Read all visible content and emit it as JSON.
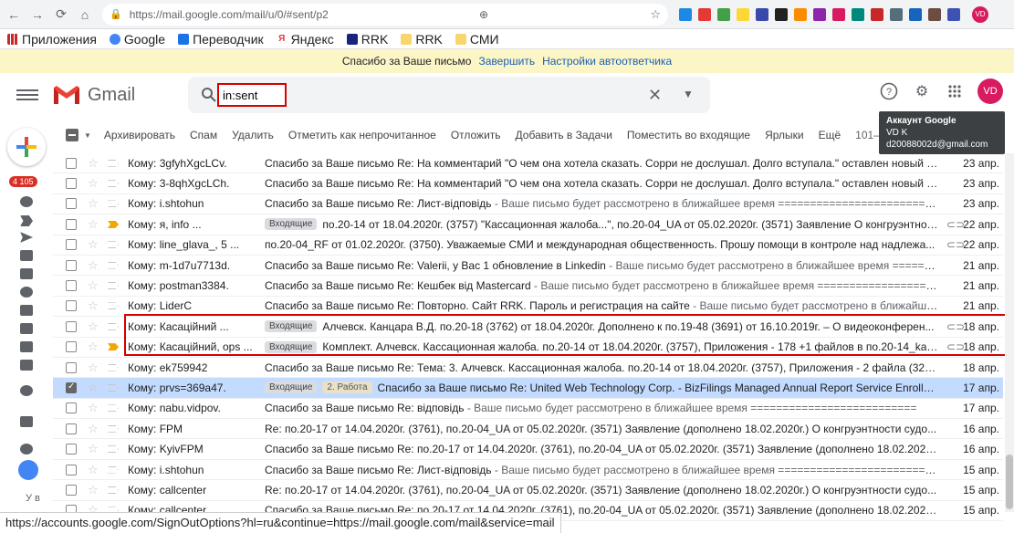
{
  "browser": {
    "url": "https://mail.google.com/mail/u/0/#sent/p2",
    "profile_initials": "VD"
  },
  "bookmarks": [
    {
      "label": "Приложения"
    },
    {
      "label": "Google"
    },
    {
      "label": "Переводчик"
    },
    {
      "label": "Яндекс"
    },
    {
      "label": "RRK"
    },
    {
      "label": "RRK"
    },
    {
      "label": "СМИ"
    }
  ],
  "vacation": {
    "text": "Спасибо за Ваше письмо",
    "end_link": "Завершить",
    "settings_link": "Настройки автоответчика"
  },
  "header": {
    "app_name": "Gmail",
    "search_value": "in:sent",
    "avatar_initials": "VD"
  },
  "tooltip": {
    "title": "Аккаунт Google",
    "name": "VD K",
    "email": "d20088002d@gmail.com"
  },
  "rail": {
    "unread_count": "4 105",
    "user_label": "У в"
  },
  "toolbar": {
    "archive": "Архивировать",
    "spam": "Спам",
    "delete": "Удалить",
    "mark_unread": "Отметить как непрочитанное",
    "snooze": "Отложить",
    "add_tasks": "Добавить в Задачи",
    "move_inbox": "Поместить во входящие",
    "labels": "Ярлыки",
    "more": "Ещё",
    "range": "101–"
  },
  "emails": [
    {
      "from": "Кому: 3gfyhXgcLCv.",
      "labels": [],
      "subject": "Спасибо за Ваше письмо Re: На комментарий \"О чем она хотела сказать. Сорри не дослушал. Долго вступала.\" оставлен новый от...",
      "snippet": "",
      "attach": false,
      "important": false,
      "selected": false,
      "date": "23 апр."
    },
    {
      "from": "Кому: 3-8qhXgcLCh.",
      "labels": [],
      "subject": "Спасибо за Ваше письмо Re: На комментарий \"О чем она хотела сказать. Сорри не дослушал. Долго вступала.\" оставлен новый от...",
      "snippet": "",
      "attach": false,
      "important": false,
      "selected": false,
      "date": "23 апр."
    },
    {
      "from": "Кому: i.shtohun",
      "labels": [],
      "subject": "Спасибо за Ваше письмо Re: Лист-відповідь",
      "snippet": " - Ваше письмо будет рассмотрено в ближайшее время ==========================",
      "attach": false,
      "important": false,
      "selected": false,
      "date": "23 апр."
    },
    {
      "from": "Кому: я, info ...",
      "labels": [
        "Входящие"
      ],
      "subject": "по.20-14 от 18.04.2020г. (3757) \"Кассационная жалоба...\", по.20-04_UA от 05.02.2020г. (3571) Заявление О конгруэнтност...",
      "snippet": "",
      "attach": true,
      "important": true,
      "selected": false,
      "date": "22 апр."
    },
    {
      "from": "Кому: line_glava_, 5 ...",
      "labels": [],
      "subject": "по.20-04_RF от 01.02.2020г. (3750). Уважаемые СМИ и международная общественность. Прошу помощи в контроле над надлежа...",
      "snippet": "",
      "attach": true,
      "important": false,
      "selected": false,
      "date": "22 апр."
    },
    {
      "from": "Кому: m-1d7u7713d.",
      "labels": [],
      "subject": "Спасибо за Ваше письмо Re: Valerii, у Вас 1 обновление в Linkedin",
      "snippet": " - Ваше письмо будет рассмотрено в ближайшее время ==========",
      "attach": false,
      "important": false,
      "selected": false,
      "date": "21 апр."
    },
    {
      "from": "Кому: postman3384.",
      "labels": [],
      "subject": "Спасибо за Ваше письмо Re: Кешбек від Mastercard",
      "snippet": " - Ваше письмо будет рассмотрено в ближайшее время =====================",
      "attach": false,
      "important": false,
      "selected": false,
      "date": "21 апр."
    },
    {
      "from": "Кому: LiderC",
      "labels": [],
      "subject": "Спасибо за Ваше письмо Re: Повторно. Сайт RRK. Пароль и регистрация на сайте",
      "snippet": " - Ваше письмо будет рассмотрено в ближайшее ...",
      "attach": false,
      "important": false,
      "selected": false,
      "date": "21 апр."
    },
    {
      "from": "Кому: Касаційний ...",
      "labels": [
        "Входящие"
      ],
      "subject": "Алчевск. Канцара В.Д. по.20-18 (3762) от 18.04.2020г. Дополнено к по.19-48 (3691) от 16.10.2019г. – О видеоконферен...",
      "snippet": "",
      "attach": true,
      "important": false,
      "selected": false,
      "date": "18 апр."
    },
    {
      "from": "Кому: Касаційний, ops ...",
      "labels": [
        "Входящие"
      ],
      "subject": "Комплект. Алчевск. Кассационная жалоба. по.20-14 от 18.04.2020г. (3757), Приложения - 178 +1 файлов в по.20-14_kas...",
      "snippet": "",
      "attach": true,
      "important": true,
      "selected": false,
      "date": "18 апр."
    },
    {
      "from": "Кому: ek759942",
      "labels": [],
      "subject": "Спасибо за Ваше письмо Re: Тема: 3. Алчевск. Кассационная жалоба. по.20-14 от 18.04.2020г. (3757), Приложения - 2 файла (324,...",
      "snippet": "",
      "attach": false,
      "important": false,
      "selected": false,
      "date": "18 апр."
    },
    {
      "from": "Кому: prvs=369a47.",
      "labels": [
        "Входящие",
        "2. Работа"
      ],
      "subject": "Спасибо за Ваше письмо Re: United Web Technology Corp. - BizFilings Managed Annual Report Service Enrollment ...",
      "snippet": "",
      "attach": false,
      "important": false,
      "selected": true,
      "date": "17 апр."
    },
    {
      "from": "Кому: nabu.vidpov.",
      "labels": [],
      "subject": "Спасибо за Ваше письмо Re: відповідь",
      "snippet": " - Ваше письмо будет рассмотрено в ближайшее время ==========================",
      "attach": false,
      "important": false,
      "selected": false,
      "date": "17 апр."
    },
    {
      "from": "Кому: FPM",
      "labels": [],
      "subject": "Re: по.20-17 от 14.04.2020г. (3761), по.20-04_UA от 05.02.2020г. (3571) Заявление (дополнено 18.02.2020г.) О конгруэнтности судо...",
      "snippet": "",
      "attach": false,
      "important": false,
      "selected": false,
      "date": "16 апр."
    },
    {
      "from": "Кому: KyivFPM",
      "labels": [],
      "subject": "Спасибо за Ваше письмо Re: по.20-17 от 14.04.2020г. (3761), по.20-04_UA от 05.02.2020г. (3571) Заявление (дополнено 18.02.2020...",
      "snippet": "",
      "attach": false,
      "important": false,
      "selected": false,
      "date": "16 апр."
    },
    {
      "from": "Кому: i.shtohun",
      "labels": [],
      "subject": "Спасибо за Ваше письмо Re: Лист-відповідь",
      "snippet": " - Ваше письмо будет рассмотрено в ближайшее время ==========================",
      "attach": false,
      "important": false,
      "selected": false,
      "date": "15 апр."
    },
    {
      "from": "Кому: callcenter",
      "labels": [],
      "subject": "Re: по.20-17 от 14.04.2020г. (3761), по.20-04_UA от 05.02.2020г. (3571) Заявление (дополнено 18.02.2020г.) О конгруэнтности судо...",
      "snippet": "",
      "attach": false,
      "important": false,
      "selected": false,
      "date": "15 апр."
    },
    {
      "from": "Кому: callcenter",
      "labels": [],
      "subject": "Спасибо за Ваше письмо Re: по.20-17 от 14.04.2020г. (3761), по.20-04_UA от 05.02.2020г. (3571) Заявление (дополнено 18.02.2020...",
      "snippet": "",
      "attach": false,
      "important": false,
      "selected": false,
      "date": "15 апр."
    }
  ],
  "statusbar": {
    "text": "https://accounts.google.com/SignOutOptions?hl=ru&continue=https://mail.google.com/mail&service=mail"
  }
}
